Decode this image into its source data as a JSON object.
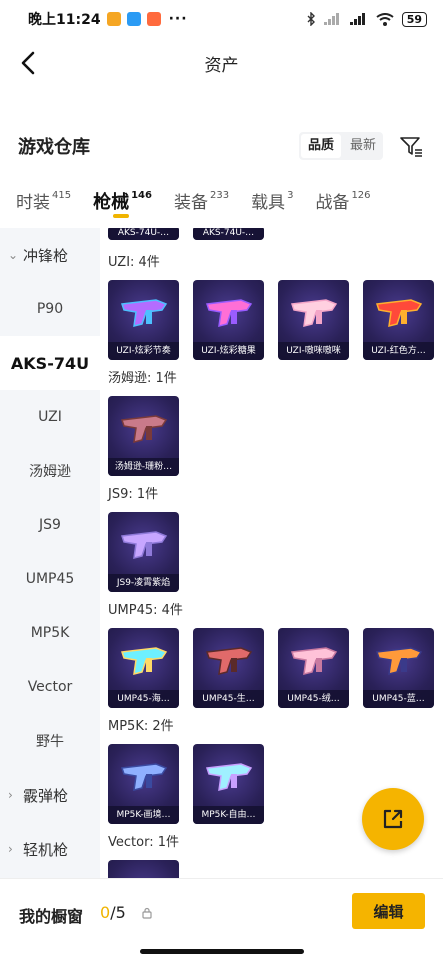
{
  "status_bar": {
    "time": "晚上11:24",
    "more": "···",
    "battery": "59"
  },
  "nav": {
    "title": "资产"
  },
  "header": {
    "title": "游戏仓库",
    "sort_quality": "品质",
    "sort_latest": "最新"
  },
  "tabs": [
    {
      "label": "时装",
      "count": "415"
    },
    {
      "label": "枪械",
      "count": "146"
    },
    {
      "label": "装备",
      "count": "233"
    },
    {
      "label": "载具",
      "count": "3"
    },
    {
      "label": "战备",
      "count": "126"
    }
  ],
  "sidebar": {
    "items": [
      "冲锋枪",
      "P90",
      "AKS-74U",
      "UZI",
      "汤姆逊",
      "JS9",
      "UMP45",
      "MP5K",
      "Vector",
      "野牛",
      "霰弹枪",
      "轻机枪"
    ]
  },
  "top_partial": [
    "AKS-74U-…",
    "AKS-74U-…"
  ],
  "sections": [
    {
      "title": "UZI: 4件",
      "items": [
        "UZI-炫彩节奏",
        "UZI-炫彩糖果",
        "UZI-嗷咪嗷咪",
        "UZI-红色方…"
      ]
    },
    {
      "title": "汤姆逊: 1件",
      "items": [
        "汤姆逊-珊粉…"
      ]
    },
    {
      "title": "JS9: 1件",
      "items": [
        "JS9-凌霄紫焰"
      ]
    },
    {
      "title": "UMP45: 4件",
      "items": [
        "UMP45-海…",
        "UMP45-生…",
        "UMP45-绒…",
        "UMP45-蓝…"
      ]
    },
    {
      "title": "MP5K: 2件",
      "items": [
        "MP5K-画境…",
        "MP5K-自由…"
      ]
    },
    {
      "title": "Vector: 1件",
      "items": []
    }
  ],
  "bottom": {
    "title": "我的橱窗",
    "count_value": "0",
    "count_total": "/5",
    "edit": "编辑"
  },
  "colors": {
    "accent": "#f5b400",
    "card_bg": "#2a2158"
  },
  "icons": {
    "back": "chevron-left-icon",
    "filter": "filter-icon",
    "share": "external-link-icon",
    "lock": "lock-icon"
  }
}
